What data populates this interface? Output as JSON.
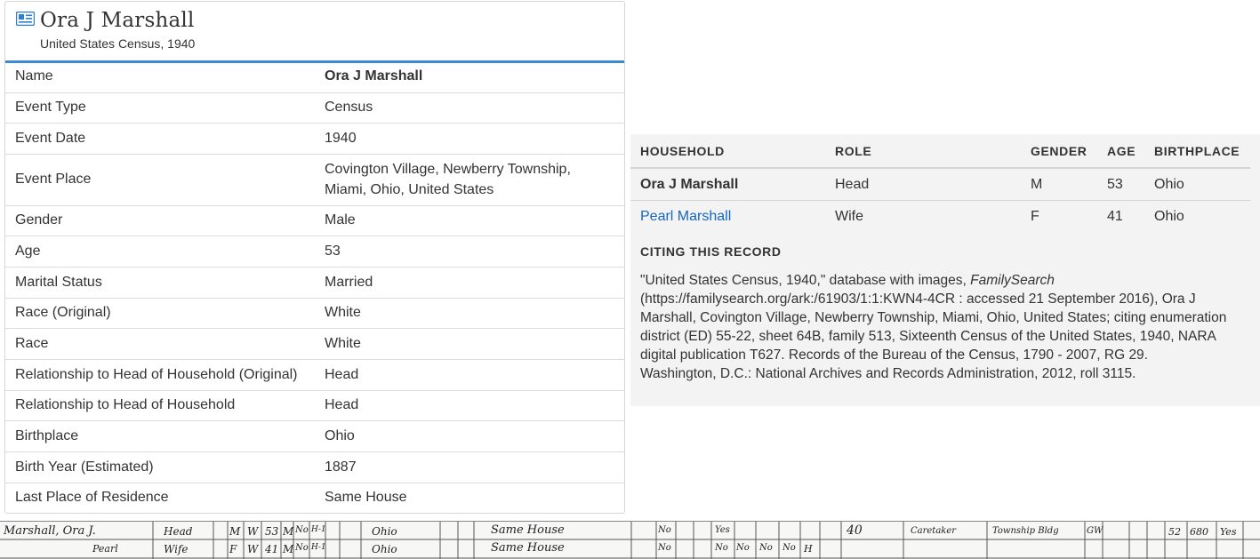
{
  "record": {
    "title": "Ora J Marshall",
    "collection": "United States Census, 1940",
    "icon": "record-icon"
  },
  "facts": [
    {
      "label": "Name",
      "value": "Ora J Marshall"
    },
    {
      "label": "Event Type",
      "value": "Census"
    },
    {
      "label": "Event Date",
      "value": "1940"
    },
    {
      "label": "Event Place",
      "value": "Covington Village, Newberry Township,",
      "value2": "Miami, Ohio, United States"
    },
    {
      "label": "Gender",
      "value": "Male"
    },
    {
      "label": "Age",
      "value": "53"
    },
    {
      "label": "Marital Status",
      "value": "Married"
    },
    {
      "label": "Race (Original)",
      "value": "White"
    },
    {
      "label": "Race",
      "value": "White"
    },
    {
      "label": "Relationship to Head of Household (Original)",
      "value": "Head"
    },
    {
      "label": "Relationship to Head of Household",
      "value": "Head"
    },
    {
      "label": "Birthplace",
      "value": "Ohio"
    },
    {
      "label": "Birth Year (Estimated)",
      "value": "1887"
    },
    {
      "label": "Last Place of Residence",
      "value": "Same House"
    }
  ],
  "household": {
    "headers": [
      "HOUSEHOLD",
      "ROLE",
      "GENDER",
      "AGE",
      "BIRTHPLACE"
    ],
    "rows": [
      {
        "name": "Ora J Marshall",
        "role": "Head",
        "gender": "M",
        "age": "53",
        "birthplace": "Ohio"
      },
      {
        "name": "Pearl Marshall",
        "role": "Wife",
        "gender": "F",
        "age": "41",
        "birthplace": "Ohio"
      }
    ]
  },
  "citation": {
    "heading": "CITING THIS RECORD",
    "text_before": "\"United States Census, 1940,\" database with images, ",
    "italic": "FamilySearch",
    "text_after": " (https://familysearch.org/ark:/61903/1:1:KWN4-4CR : accessed 21 September 2016), Ora J Marshall, Covington Village, Newberry Township, Miami, Ohio, United States; citing enumeration district (ED) 55-22, sheet 64B, family 513, Sixteenth Census of the United States, 1940, NARA digital publication T627. Records of the Bureau of the Census, 1790 - 2007, RG 29. Washington, D.C.: National Archives and Records Administration, 2012, roll 3115."
  },
  "colors": {
    "accent": "#3b8bd0",
    "link": "#1565c0",
    "panel_bg": "#f3f3f3"
  },
  "census_image": {
    "row1": [
      "Marshall, Ora J.",
      "Head",
      "M",
      "W",
      "53",
      "M",
      "No",
      "H-1",
      "Ohio",
      "Same House",
      "No",
      "Yes",
      "40",
      "Caretaker",
      "Township Bldg",
      "GW",
      "52",
      "680",
      "Yes"
    ],
    "row2": [
      "Pearl",
      "Wife",
      "F",
      "W",
      "41",
      "M",
      "No",
      "H-1",
      "Ohio",
      "Same House",
      "No",
      "No",
      "No",
      "No",
      "No",
      "H"
    ]
  }
}
